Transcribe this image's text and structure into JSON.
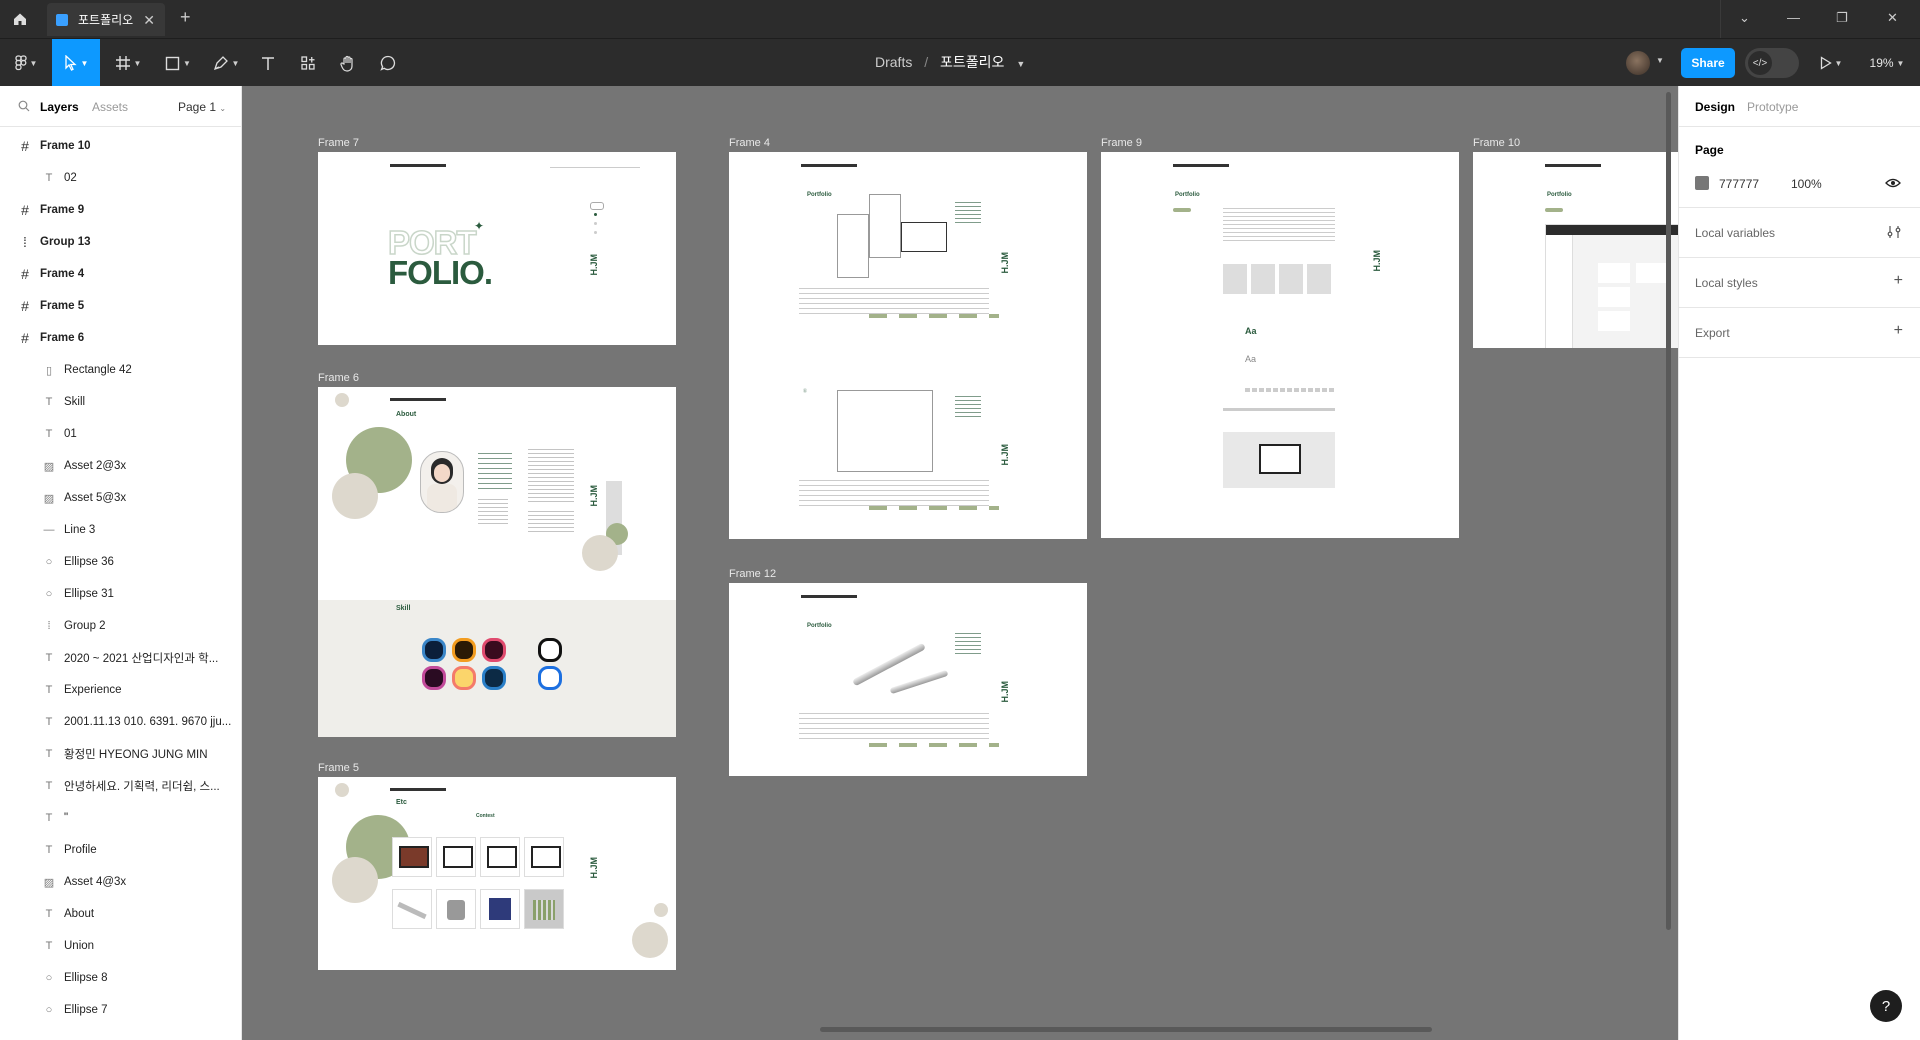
{
  "titlebar": {
    "tab_title": "포트폴리오"
  },
  "toolbar": {
    "breadcrumb_root": "Drafts",
    "breadcrumb_sep": "/",
    "breadcrumb_file": "포트폴리오",
    "share_label": "Share",
    "zoom": "19%"
  },
  "left_panel": {
    "tab_layers": "Layers",
    "tab_assets": "Assets",
    "page_selector": "Page 1",
    "layers": [
      {
        "label": "Frame 10",
        "kind": "frame",
        "level": 0
      },
      {
        "label": "02",
        "kind": "text",
        "level": 1
      },
      {
        "label": "Frame 9",
        "kind": "frame",
        "level": 0
      },
      {
        "label": "Group 13",
        "kind": "group",
        "level": 0
      },
      {
        "label": "Frame 4",
        "kind": "frame",
        "level": 0
      },
      {
        "label": "Frame 5",
        "kind": "frame",
        "level": 0
      },
      {
        "label": "Frame 6",
        "kind": "frame",
        "level": 0
      },
      {
        "label": "Rectangle 42",
        "kind": "rect",
        "level": 1
      },
      {
        "label": "Skill",
        "kind": "text",
        "level": 1
      },
      {
        "label": "01",
        "kind": "text",
        "level": 1
      },
      {
        "label": "Asset 2@3x",
        "kind": "image",
        "level": 1
      },
      {
        "label": "Asset 5@3x",
        "kind": "image",
        "level": 1
      },
      {
        "label": "Line 3",
        "kind": "line",
        "level": 1
      },
      {
        "label": "Ellipse 36",
        "kind": "ellipse",
        "level": 1
      },
      {
        "label": "Ellipse 31",
        "kind": "ellipse",
        "level": 1
      },
      {
        "label": "Group 2",
        "kind": "group",
        "level": 1
      },
      {
        "label": "2020 ~ 2021 산업디자인과 학...",
        "kind": "text",
        "level": 1
      },
      {
        "label": "Experience",
        "kind": "text",
        "level": 1
      },
      {
        "label": "2001.11.13 010. 6391. 9670 jju...",
        "kind": "text",
        "level": 1
      },
      {
        "label": "황정민 HYEONG JUNG MIN",
        "kind": "text",
        "level": 1
      },
      {
        "label": "안녕하세요. 기획력, 리더쉽, 스...",
        "kind": "text",
        "level": 1
      },
      {
        "label": "\"",
        "kind": "text",
        "level": 1
      },
      {
        "label": "Profile",
        "kind": "text",
        "level": 1
      },
      {
        "label": "Asset 4@3x",
        "kind": "image",
        "level": 1
      },
      {
        "label": "About",
        "kind": "text",
        "level": 1
      },
      {
        "label": "Union",
        "kind": "text",
        "level": 1
      },
      {
        "label": "Ellipse 8",
        "kind": "ellipse",
        "level": 1
      },
      {
        "label": "Ellipse 7",
        "kind": "ellipse",
        "level": 1
      }
    ]
  },
  "canvas": {
    "background": "#777777",
    "frames": {
      "frame7": {
        "label": "Frame 7",
        "title1": "PORT",
        "title2": "FOLIO."
      },
      "frame6": {
        "label": "Frame 6",
        "heading": "About",
        "skill": "Skill"
      },
      "frame5": {
        "label": "Frame 5",
        "heading": "Etc",
        "contest": "Contest"
      },
      "frame4": {
        "label": "Frame 4",
        "heading": "Portfolio"
      },
      "frame9": {
        "label": "Frame 9",
        "heading": "Portfolio"
      },
      "frame10": {
        "label": "Frame 10",
        "heading": "Portfolio"
      },
      "frame12": {
        "label": "Frame 12",
        "heading": "Portfolio"
      }
    },
    "brand_mark": "H.JM"
  },
  "right_panel": {
    "tab_design": "Design",
    "tab_prototype": "Prototype",
    "page_heading": "Page",
    "page_color_hex": "777777",
    "page_opacity": "100%",
    "local_variables": "Local variables",
    "local_styles": "Local styles",
    "export": "Export"
  },
  "help": "?"
}
